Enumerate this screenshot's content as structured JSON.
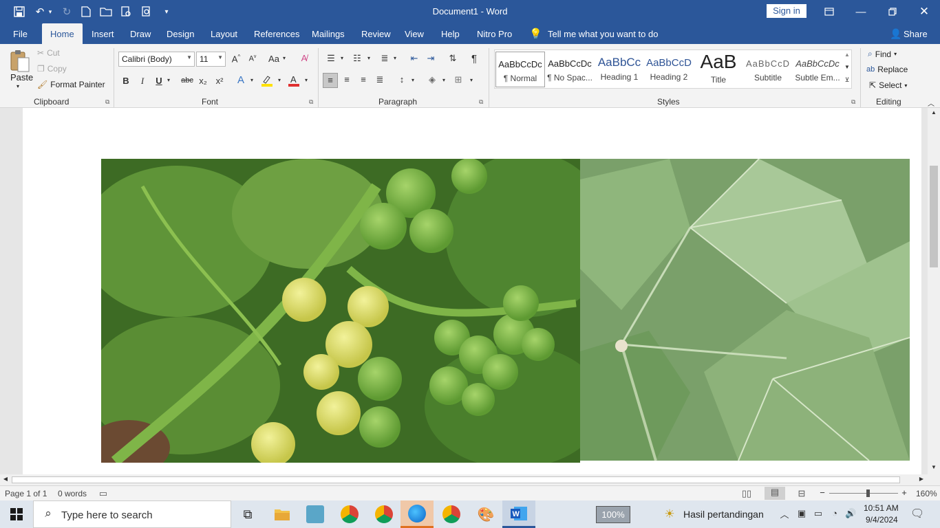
{
  "window": {
    "title": "Document1  -  Word",
    "sign_in": "Sign in"
  },
  "menu": {
    "tabs": [
      "File",
      "Home",
      "Insert",
      "Draw",
      "Design",
      "Layout",
      "References",
      "Mailings",
      "Review",
      "View",
      "Help",
      "Nitro Pro"
    ],
    "tell_me": "Tell me what you want to do",
    "share": "Share"
  },
  "clipboard": {
    "paste": "Paste",
    "cut": "Cut",
    "copy": "Copy",
    "format_painter": "Format Painter",
    "label": "Clipboard"
  },
  "font": {
    "name": "Calibri (Body)",
    "size": "11",
    "case": "Aa",
    "label": "Font",
    "bold": "B",
    "italic": "I",
    "underline": "U",
    "strike": "abc",
    "sub": "x₂",
    "sup": "x²"
  },
  "paragraph": {
    "label": "Paragraph"
  },
  "styles": {
    "label": "Styles",
    "items": [
      {
        "preview": "AaBbCcDc",
        "name": "¶ Normal"
      },
      {
        "preview": "AaBbCcDc",
        "name": "¶ No Spac..."
      },
      {
        "preview": "AaBbCc",
        "name": "Heading 1"
      },
      {
        "preview": "AaBbCcD",
        "name": "Heading 2"
      },
      {
        "preview": "AaB",
        "name": "Title"
      },
      {
        "preview": "AaBbCcD",
        "name": "Subtitle"
      },
      {
        "preview": "AaBbCcDc",
        "name": "Subtle Em..."
      }
    ]
  },
  "editing": {
    "find": "Find",
    "replace": "Replace",
    "select": "Select",
    "label": "Editing"
  },
  "status": {
    "page": "Page 1 of 1",
    "words": "0 words",
    "zoom": "160%"
  },
  "taskbar": {
    "search_placeholder": "Type here to search",
    "battery": "100%",
    "news": "Hasil pertandingan",
    "time": "10:51 AM",
    "date": "9/4/2024"
  },
  "colors": {
    "accent": "#2b579a",
    "ribbon_bg": "#f3f3f3",
    "font_color": "#e03030",
    "highlight": "#ffe100"
  }
}
